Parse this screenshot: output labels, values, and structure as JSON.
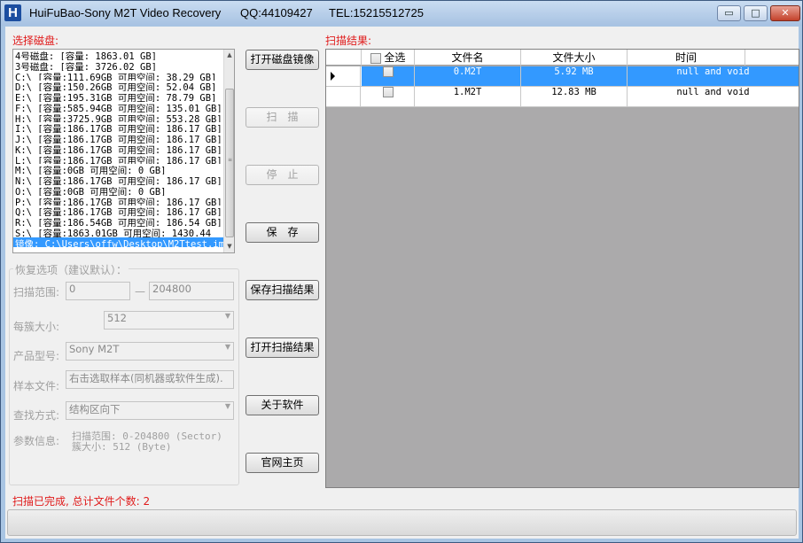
{
  "window": {
    "title": "HuiFuBao-Sony M2T Video Recovery",
    "qq": "QQ:44109427",
    "tel": "TEL:15215512725",
    "minimize_glyph": "▭",
    "maximize_glyph": "□",
    "close_glyph": "✕"
  },
  "disk_panel": {
    "label": "选择磁盘:",
    "items": [
      "4号磁盘: [容量: 1863.01 GB]",
      "3号磁盘: [容量: 3726.02 GB]",
      "C:\\ [容量:111.69GB 可用空间: 38.29 GB]",
      "D:\\ [容量:150.26GB 可用空间: 52.04 GB]",
      "E:\\ [容量:195.31GB 可用空间: 78.79 GB]",
      "F:\\ [容量:585.94GB 可用空间: 135.01 GB]",
      "H:\\ [容量:3725.9GB 可用空间: 553.28 GB]",
      "I:\\ [容量:186.17GB 可用空间: 186.17 GB]",
      "J:\\ [容量:186.17GB 可用空间: 186.17 GB]",
      "K:\\ [容量:186.17GB 可用空间: 186.17 GB]",
      "L:\\ [容量:186.17GB 可用空间: 186.17 GB]",
      "M:\\ [容量:0GB 可用空间: 0 GB]",
      "N:\\ [容量:186.17GB 可用空间: 186.17 GB]",
      "O:\\ [容量:0GB 可用空间: 0 GB]",
      "P:\\ [容量:186.17GB 可用空间: 186.17 GB]",
      "Q:\\ [容量:186.17GB 可用空间: 186.17 GB]",
      "R:\\ [容量:186.54GB 可用空间: 186.54 GB]",
      "S:\\ [容量:1863.01GB 可用空间: 1430.44",
      "镜像: C:\\Users\\offw\\Desktop\\M2Ttest.im"
    ],
    "selected_index": 18,
    "scroll_up": "▲",
    "scroll_down": "▼"
  },
  "buttons": {
    "open_image": "打开磁盘镜像",
    "scan": "扫　描",
    "stop": "停　止",
    "save": "保　存",
    "save_scan": "保存扫描结果",
    "open_scan": "打开扫描结果",
    "about": "关于软件",
    "homepage": "官网主页"
  },
  "options": {
    "legend": "恢复选项（建议默认）：",
    "scan_range_label": "扫描范围:",
    "scan_range_from": "0",
    "range_dash": "—",
    "scan_range_to": "204800",
    "cluster_label": "每簇大小:",
    "cluster_value": "512",
    "model_label": "产品型号:",
    "model_value": "Sony M2T",
    "sample_label": "样本文件:",
    "sample_value": "右击选取样本(同机器或软件生成).",
    "search_label": "查找方式:",
    "search_value": "结构区向下",
    "param_label": "参数信息:",
    "param_line1": "扫描范围: 0-204800  (Sector)",
    "param_line2": "簇大小: 512  (Byte)",
    "dropdown_glyph": "▼"
  },
  "results": {
    "label": "扫描结果:",
    "headers": {
      "select_all": "全选",
      "name": "文件名",
      "size": "文件大小",
      "time": "时间"
    },
    "rows": [
      {
        "name": "0.M2T",
        "size": "5.92 MB",
        "time": "null and void"
      },
      {
        "name": "1.M2T",
        "size": "12.83 MB",
        "time": "null and void"
      }
    ]
  },
  "status": {
    "text": "扫描已完成, 总计文件个数: 2",
    "progress_percent": 0
  }
}
